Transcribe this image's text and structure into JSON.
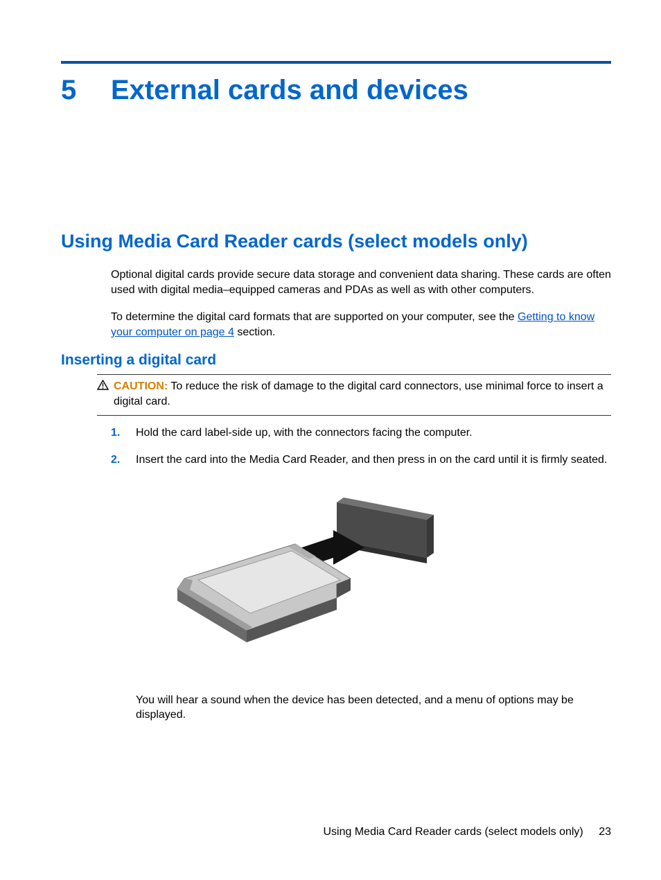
{
  "chapter": {
    "number": "5",
    "title": "External cards and devices"
  },
  "section": {
    "title": "Using Media Card Reader cards (select models only)",
    "para1": "Optional digital cards provide secure data storage and convenient data sharing. These cards are often used with digital media–equipped cameras and PDAs as well as with other computers.",
    "para2_pre": "To determine the digital card formats that are supported on your computer, see the ",
    "para2_link": "Getting to know your computer on page 4",
    "para2_post": " section."
  },
  "subsection": {
    "title": "Inserting a digital card",
    "caution_label": "CAUTION:",
    "caution_text": "   To reduce the risk of damage to the digital card connectors, use minimal force to insert a digital card.",
    "steps": [
      {
        "num": "1.",
        "text": "Hold the card label-side up, with the connectors facing the computer."
      },
      {
        "num": "2.",
        "text": "Insert the card into the Media Card Reader, and then press in on the card until it is firmly seated."
      }
    ],
    "after_figure": "You will hear a sound when the device has been detected, and a menu of options may be displayed."
  },
  "footer": {
    "text": "Using Media Card Reader cards (select models only)",
    "page": "23"
  }
}
